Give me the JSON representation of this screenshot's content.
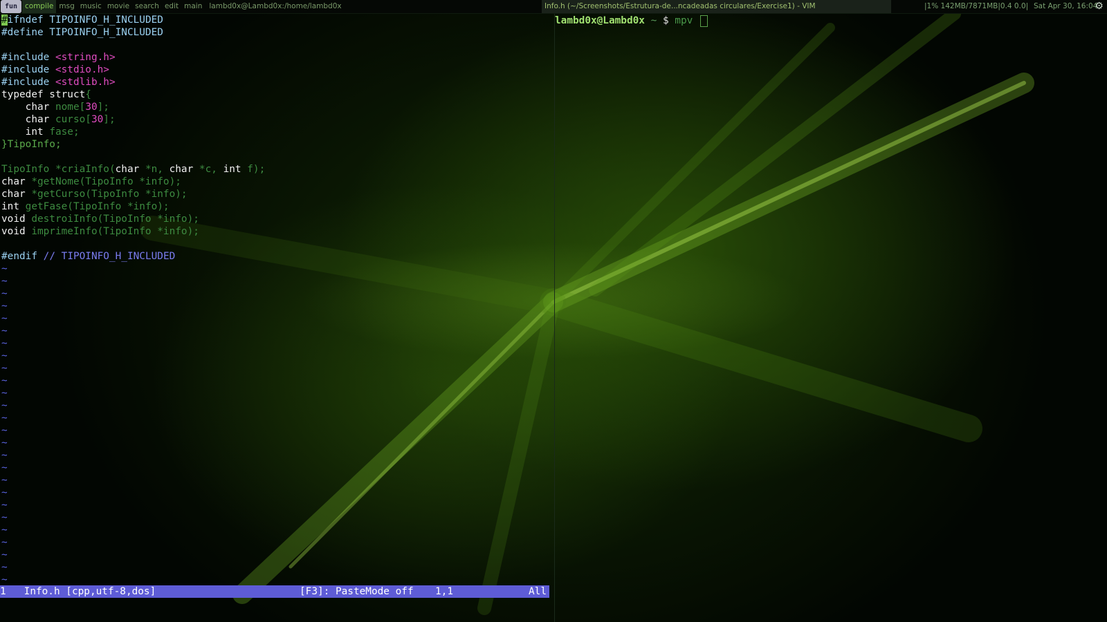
{
  "topbar": {
    "logo": "fun",
    "tags": [
      {
        "label": "compile",
        "active": true
      },
      {
        "label": "msg"
      },
      {
        "label": "music"
      },
      {
        "label": "movie"
      },
      {
        "label": "search"
      },
      {
        "label": "edit"
      },
      {
        "label": "main"
      }
    ],
    "terminal_tab": "lambd0x@Lambd0x:/home/lambd0x",
    "window_title": "Info.h (~/Screenshots/Estrutura-de...ncadeadas circulares/Exercise1) - VIM",
    "status": "|1% 142MB/7871MB|0.4 0.0|",
    "datetime": "Sat Apr 30, 16:04"
  },
  "vim": {
    "cursor_char": "#",
    "lines": {
      "l1": {
        "a": "ifndef TIPOINFO_H_INCLUDED"
      },
      "l2": {
        "a": "#define TIPOINFO_H_INCLUDED"
      },
      "l4": {
        "a": "#include ",
        "b": "<string.h>"
      },
      "l5": {
        "a": "#include ",
        "b": "<stdio.h>"
      },
      "l6": {
        "a": "#include ",
        "b": "<stdlib.h>"
      },
      "l7": {
        "a": "typedef struct",
        "b": "{"
      },
      "l8": {
        "a": "    char ",
        "b": "nome[",
        "c": "30",
        "d": "];"
      },
      "l9": {
        "a": "    char ",
        "b": "curso[",
        "c": "30",
        "d": "];"
      },
      "l10": {
        "a": "    int ",
        "b": "fase;"
      },
      "l11": {
        "a": "}TipoInfo;"
      },
      "l13": {
        "a": "TipoInfo *criaInfo(",
        "b": "char",
        "c": " *n, ",
        "d": "char",
        "e": " *c, ",
        "f": "int",
        "g": " f);"
      },
      "l14": {
        "a": "char",
        "b": " *getNome(TipoInfo *info);"
      },
      "l15": {
        "a": "char",
        "b": " *getCurso(TipoInfo *info);"
      },
      "l16": {
        "a": "int",
        "b": " getFase(TipoInfo *info);"
      },
      "l17": {
        "a": "void",
        "b": " destroiInfo(TipoInfo *info);"
      },
      "l18": {
        "a": "void",
        "b": " imprimeInfo(TipoInfo *info);"
      },
      "l20": {
        "a": "#endif ",
        "b": "// ",
        "c": "TIPOINFO_H_INCLUDED"
      }
    },
    "tilde": "~",
    "statusline": {
      "buffer": "1   Info.h [cpp,utf-8,dos]",
      "mode": "[F3]: PasteMode off",
      "position": "1,1",
      "scroll": "All"
    }
  },
  "terminal": {
    "user": "lambd0x@Lambd0x",
    "path": " ~ ",
    "dollar": "$ ",
    "command": "mpv "
  },
  "colors": {
    "accent": "#88cc55",
    "statusline_bg": "#5e5cd6",
    "preprocessor": "#9ad0f0",
    "string_literal": "#e04cc0"
  }
}
